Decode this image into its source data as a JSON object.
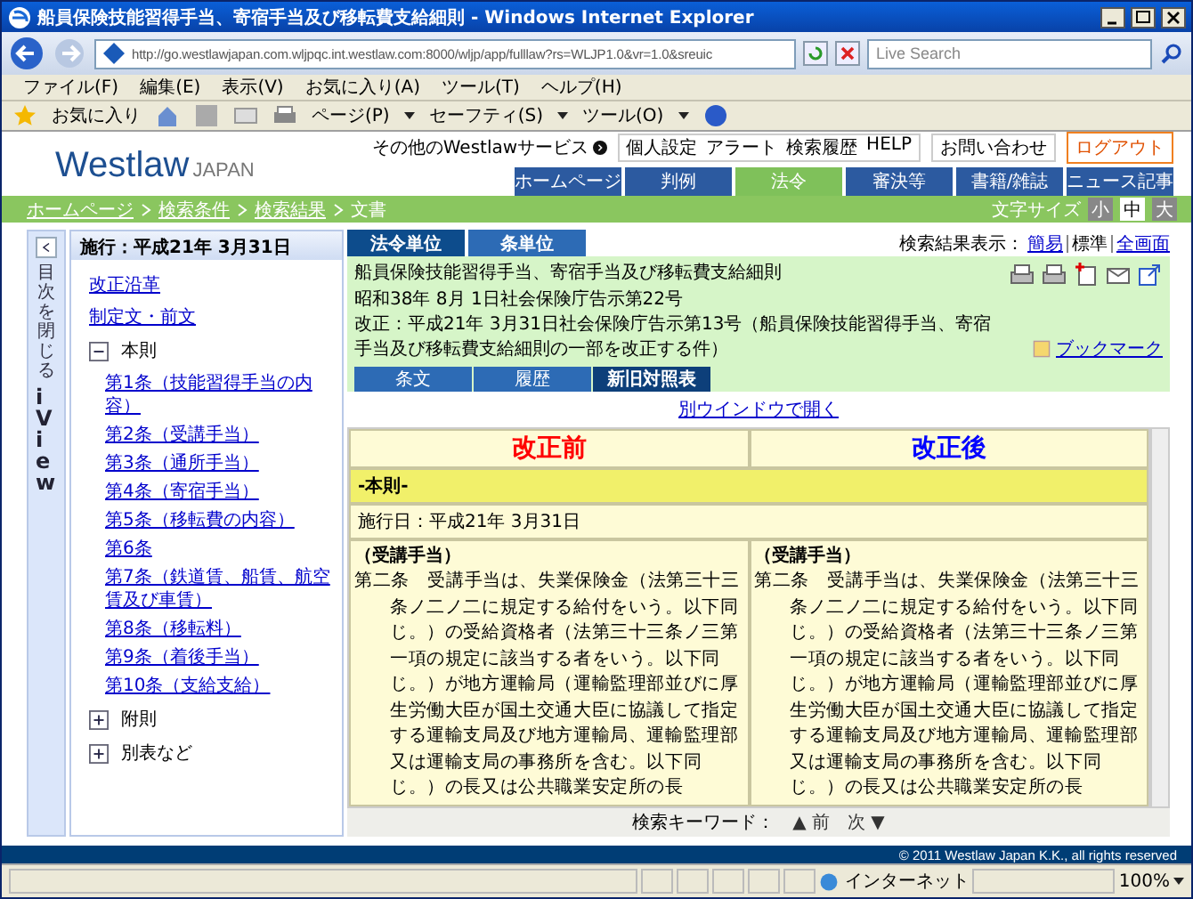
{
  "window": {
    "title": "船員保険技能習得手当、寄宿手当及び移転費支給細則 - Windows Internet Explorer"
  },
  "address": {
    "url": "http://go.westlawjapan.com.wljpqc.int.westlaw.com:8000/wljp/app/fulllaw?rs=WLJP1.0&vr=1.0&sreuic",
    "search_placeholder": "Live Search"
  },
  "menu": [
    "ファイル(F)",
    "編集(E)",
    "表示(V)",
    "お気に入り(A)",
    "ツール(T)",
    "ヘルプ(H)"
  ],
  "favorites": {
    "label": "お気に入り",
    "commands": [
      "ページ(P)",
      "セーフティ(S)",
      "ツール(O)"
    ]
  },
  "site": {
    "logo": "Westlaw",
    "logo_sub": "JAPAN",
    "other_services": "その他のWestlawサービス",
    "utilities": [
      "個人設定",
      "アラート",
      "検索履歴",
      "HELP"
    ],
    "contact": "お問い合わせ",
    "logout": "ログアウト",
    "nav": [
      {
        "label": "ホームページ",
        "selected": false
      },
      {
        "label": "判例",
        "selected": false
      },
      {
        "label": "法令",
        "selected": true
      },
      {
        "label": "審決等",
        "selected": false
      },
      {
        "label": "書籍/雑誌",
        "selected": false
      },
      {
        "label": "ニュース記事",
        "selected": false
      }
    ]
  },
  "breadcrumb": [
    {
      "label": "ホームページ",
      "link": true
    },
    {
      "label": "検索条件",
      "link": true
    },
    {
      "label": "検索結果",
      "link": true
    },
    {
      "label": "文書",
      "link": false
    }
  ],
  "font_size": {
    "label": "文字サイズ",
    "options": [
      {
        "label": "小",
        "selected": false
      },
      {
        "label": "中",
        "selected": true
      },
      {
        "label": "大",
        "selected": false
      }
    ]
  },
  "sidebar": {
    "collapse_label": "目次を閉じる",
    "brand": "iView",
    "header": "施行：平成21年 3月31日",
    "items": [
      {
        "kind": "link",
        "label": "改正沿革"
      },
      {
        "kind": "link",
        "label": "制定文・前文"
      },
      {
        "kind": "folder",
        "label": "本則",
        "expanded": true,
        "children": [
          {
            "label": "第1条（技能習得手当の内容）"
          },
          {
            "label": "第2条（受講手当）"
          },
          {
            "label": "第3条（通所手当）"
          },
          {
            "label": "第4条（寄宿手当）"
          },
          {
            "label": "第5条（移転費の内容）"
          },
          {
            "label": "第6条"
          },
          {
            "label": "第7条（鉄道賃、船賃、航空賃及び車賃）"
          },
          {
            "label": "第8条（移転料）"
          },
          {
            "label": "第9条（着後手当）"
          },
          {
            "label": "第10条（支給支給）"
          }
        ]
      },
      {
        "kind": "folder",
        "label": "附則",
        "expanded": false
      },
      {
        "kind": "folder",
        "label": "別表など",
        "expanded": false
      }
    ]
  },
  "doc_tabs": [
    {
      "label": "法令単位",
      "selected": true
    },
    {
      "label": "条単位",
      "selected": false
    }
  ],
  "display": {
    "label": "検索結果表示：",
    "options": [
      {
        "label": "簡易",
        "selected": false
      },
      {
        "label": "標準",
        "selected": true
      },
      {
        "label": "全画面",
        "selected": false
      }
    ]
  },
  "doc_info": [
    "船員保険技能習得手当、寄宿手当及び移転費支給細則",
    "昭和38年 8月 1日社会保険庁告示第22号",
    "改正：平成21年 3月31日社会保険庁告示第13号（船員保険技能習得手当、寄宿手当及び移転費支給細則の一部を改正する件）"
  ],
  "bookmark": "ブックマーク",
  "view_tabs": [
    {
      "label": "条文",
      "selected": false
    },
    {
      "label": "履歴",
      "selected": false
    },
    {
      "label": "新旧対照表",
      "selected": true
    }
  ],
  "open_window": "別ウインドウで開く",
  "compare": {
    "headers": [
      {
        "label": "改正前",
        "color": "#ff0000"
      },
      {
        "label": "改正後",
        "color": "#0000ff"
      }
    ],
    "section": "-本則-",
    "effective": "施行日：平成21年 3月31日",
    "columns": [
      {
        "heading": "（受講手当）",
        "article": "第二条",
        "body": "受講手当は、失業保険金（法第三十三条ノ二ノ二に規定する給付をいう。以下同じ。）の受給資格者（法第三十三条ノ三第一項の規定に該当する者をいう。以下同じ。）が地方運輸局（運輸監理部並びに厚生労働大臣が国土交通大臣に協議して指定する運輸支局及び地方運輸局、運輸監理部又は運輸支局の事務所を含む。以下同じ。）の長又は公共職業安定所の長"
      },
      {
        "heading": "（受講手当）",
        "article": "第二条",
        "body": "受講手当は、失業保険金（法第三十三条ノ二ノ二に規定する給付をいう。以下同じ。）の受給資格者（法第三十三条ノ三第一項の規定に該当する者をいう。以下同じ。）が地方運輸局（運輸監理部並びに厚生労働大臣が国土交通大臣に協議して指定する運輸支局及び地方運輸局、運輸監理部又は運輸支局の事務所を含む。以下同じ。）の長又は公共職業安定所の長"
      }
    ]
  },
  "keyword_nav": {
    "label": "検索キーワード：",
    "prev": "▲ 前",
    "next": "次 ▼"
  },
  "copyright": "© 2011 Westlaw Japan K.K., all rights reserved",
  "status": {
    "zone": "インターネット",
    "zoom": "100%"
  }
}
